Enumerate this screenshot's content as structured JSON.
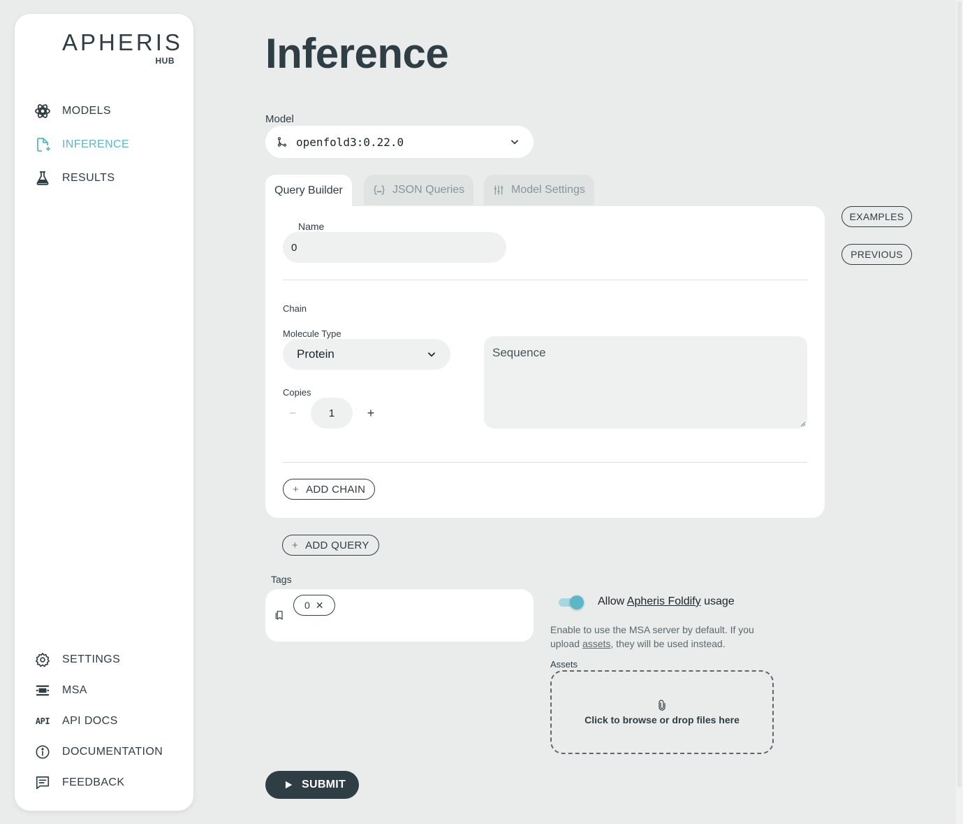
{
  "brand": {
    "name": "APHERIS",
    "sub": "HUB"
  },
  "nav_top": [
    {
      "label": "MODELS",
      "icon": "models-icon"
    },
    {
      "label": "INFERENCE",
      "icon": "new-document-icon",
      "active": true
    },
    {
      "label": "RESULTS",
      "icon": "flask-icon"
    }
  ],
  "nav_bottom": [
    {
      "label": "SETTINGS",
      "icon": "gear-icon"
    },
    {
      "label": "MSA",
      "icon": "msa-icon"
    },
    {
      "label": "API DOCS",
      "icon": "api-icon",
      "icon_text": "API"
    },
    {
      "label": "DOCUMENTATION",
      "icon": "info-icon"
    },
    {
      "label": "FEEDBACK",
      "icon": "feedback-icon"
    }
  ],
  "page": {
    "title": "Inference"
  },
  "model": {
    "label": "Model",
    "value": "openfold3:0.22.0"
  },
  "tabs": [
    {
      "label": "Query Builder",
      "active": true
    },
    {
      "label": "JSON Queries",
      "icon": "braces-icon"
    },
    {
      "label": "Model Settings",
      "icon": "sliders-icon"
    }
  ],
  "query": {
    "name_label": "Name",
    "name_value": "0",
    "chain_label": "Chain",
    "molecule_type_label": "Molecule Type",
    "molecule_type_value": "Protein",
    "copies_label": "Copies",
    "copies_value": "1",
    "copies_decrement": "−",
    "copies_increment": "+",
    "sequence_placeholder": "Sequence",
    "add_chain": "ADD CHAIN",
    "add_symbol": "+"
  },
  "side_buttons": {
    "examples": "EXAMPLES",
    "previous": "PREVIOUS"
  },
  "add_query": "ADD QUERY",
  "tags": {
    "label": "Tags",
    "items": [
      {
        "label": "0",
        "remove": "✕"
      }
    ]
  },
  "msa": {
    "toggle_on": true,
    "allow_prefix": "Allow ",
    "allow_link": "Apheris Foldify",
    "allow_suffix": " usage",
    "help_prefix": "Enable to use the MSA server by default. If you upload ",
    "help_link": "assets",
    "help_suffix": ", they will be used instead.",
    "assets_label": "Assets",
    "dropzone_text": "Click to browse or drop files here"
  },
  "submit": "SUBMIT",
  "colors": {
    "accent": "#5bb6c8",
    "dark": "#2f3d44",
    "background": "#eaeceb"
  }
}
